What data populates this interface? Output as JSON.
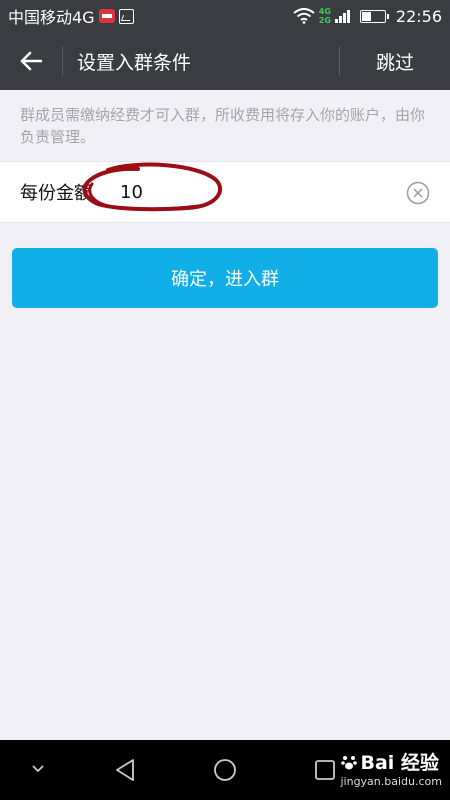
{
  "status_bar": {
    "carrier": "中国移动4G",
    "net_top": "4G",
    "net_bottom": "2G",
    "time": "22:56",
    "icons": [
      "notification-icon",
      "image-icon",
      "wifi-icon",
      "signal-icon",
      "battery-icon"
    ]
  },
  "header": {
    "title": "设置入群条件",
    "skip_label": "跳过"
  },
  "description": "群成员需缴纳经费才可入群，所收费用将存入你的账户，由你负责管理。",
  "amount": {
    "label": "每份金额",
    "value": "10"
  },
  "confirm_label": "确定，进入群",
  "watermark": {
    "brand": "Bai 经验",
    "url": "jingyan.baidu.com"
  },
  "colors": {
    "bar": "#3b3c41",
    "accent": "#12aee8",
    "page_bg": "#f0f0f6",
    "annotation": "#9b0c16"
  }
}
